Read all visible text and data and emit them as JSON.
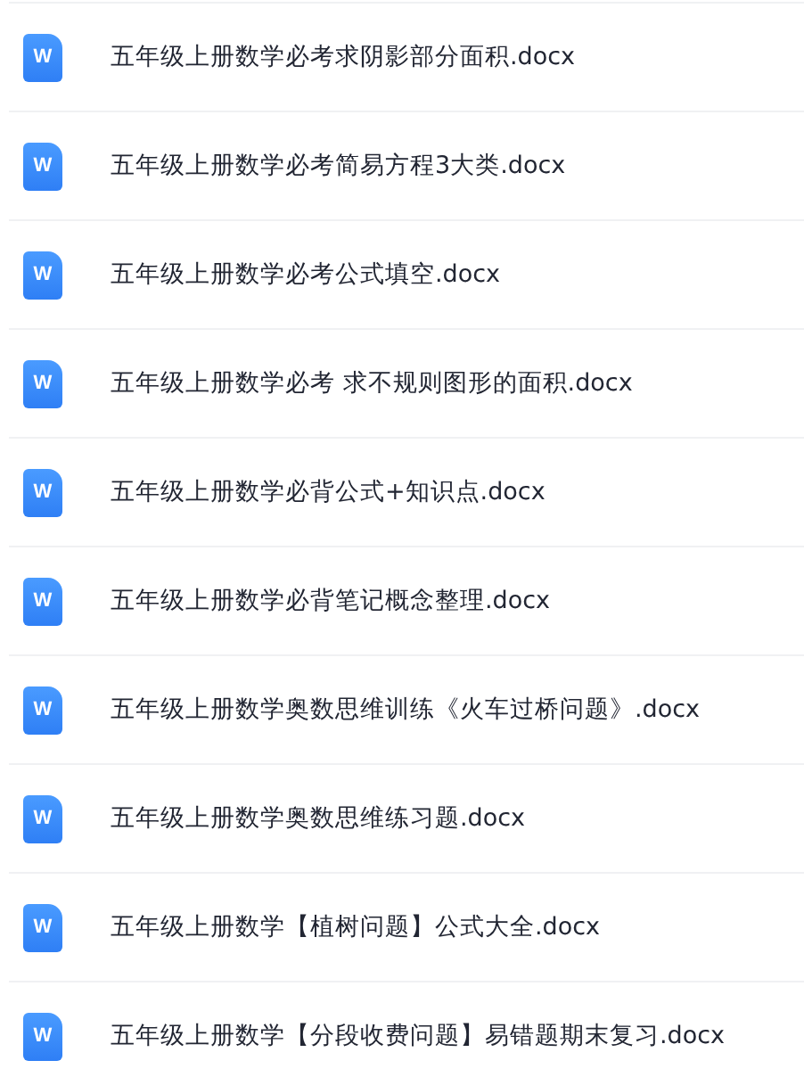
{
  "files": [
    {
      "icon": "W",
      "name": "五年级上册数学必考求阴影部分面积.docx"
    },
    {
      "icon": "W",
      "name": "五年级上册数学必考简易方程3大类.docx"
    },
    {
      "icon": "W",
      "name": "五年级上册数学必考公式填空.docx"
    },
    {
      "icon": "W",
      "name": "五年级上册数学必考 求不规则图形的面积.docx"
    },
    {
      "icon": "W",
      "name": "五年级上册数学必背公式+知识点.docx"
    },
    {
      "icon": "W",
      "name": "五年级上册数学必背笔记概念整理.docx"
    },
    {
      "icon": "W",
      "name": "五年级上册数学奥数思维训练《火车过桥问题》.docx"
    },
    {
      "icon": "W",
      "name": "五年级上册数学奥数思维练习题.docx"
    },
    {
      "icon": "W",
      "name": "五年级上册数学【植树问题】公式大全.docx"
    },
    {
      "icon": "W",
      "name": "五年级上册数学【分段收费问题】易错题期末复习.docx"
    }
  ]
}
